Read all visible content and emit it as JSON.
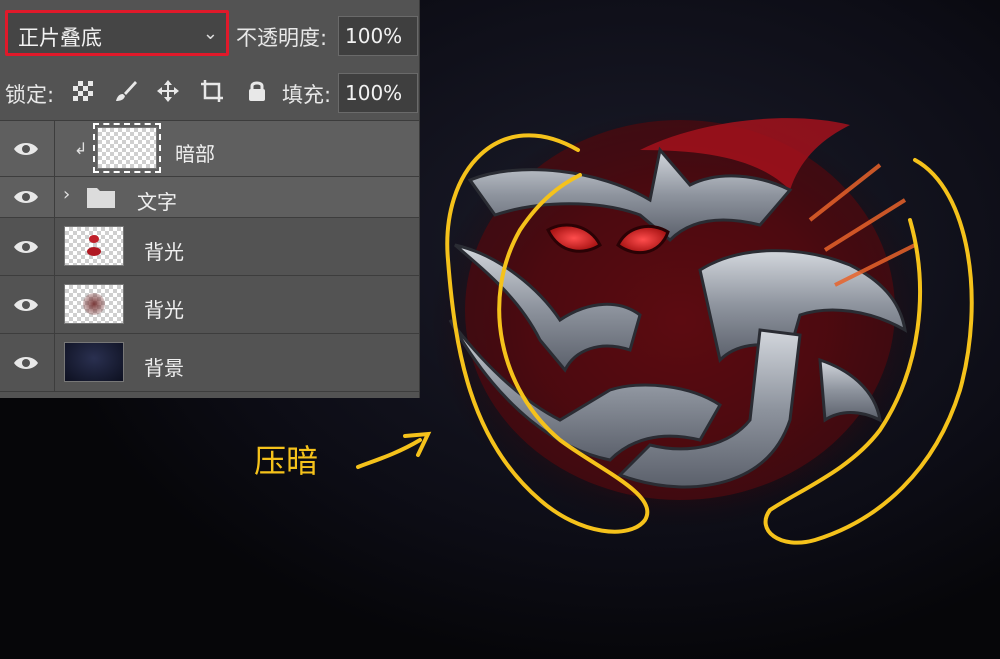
{
  "layers_panel": {
    "blend_mode": "正片叠底",
    "opacity_label": "不透明度:",
    "opacity_value": "100%",
    "lock_label": "锁定:",
    "fill_label": "填充:",
    "fill_value": "100%",
    "layers": [
      {
        "name": "暗部",
        "type": "clipped",
        "selected": true
      },
      {
        "name": "文字",
        "type": "group"
      },
      {
        "name": "背光",
        "type": "layer"
      },
      {
        "name": "背光",
        "type": "layer"
      },
      {
        "name": "背景",
        "type": "layer"
      }
    ]
  },
  "annotation": {
    "label": "压暗",
    "color": "#f5c21b"
  },
  "colors": {
    "selection_highlight": "#e0192a",
    "panel_bg": "#535353"
  }
}
